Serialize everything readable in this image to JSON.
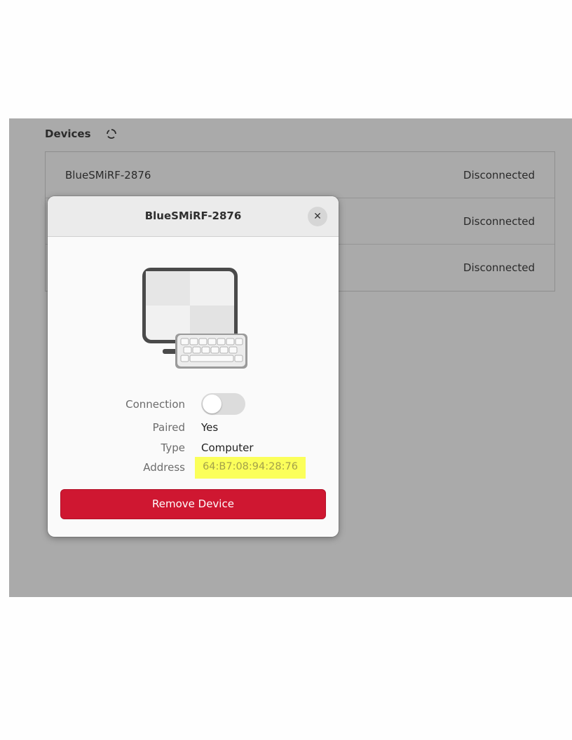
{
  "devices_section": {
    "title": "Devices",
    "spinner_icon": "refresh-spinner-icon",
    "rows": [
      {
        "name": "BlueSMiRF-2876",
        "status": "Disconnected"
      },
      {
        "name": "",
        "status": "Disconnected"
      },
      {
        "name": "",
        "status": "Disconnected"
      }
    ]
  },
  "dialog": {
    "title": "BlueSMiRF-2876",
    "close_icon": "close-icon",
    "illustration_icon": "computer-keyboard-icon",
    "connection_label": "Connection",
    "connection_on": false,
    "paired_label": "Paired",
    "paired_value": "Yes",
    "type_label": "Type",
    "type_value": "Computer",
    "address_label": "Address",
    "address_value": "64:B7:08:94:28:76",
    "remove_label": "Remove Device"
  },
  "colors": {
    "overlay_background": "#aaaaaa",
    "remove_button": "#cf1731",
    "address_highlight": "#fbff5a"
  }
}
